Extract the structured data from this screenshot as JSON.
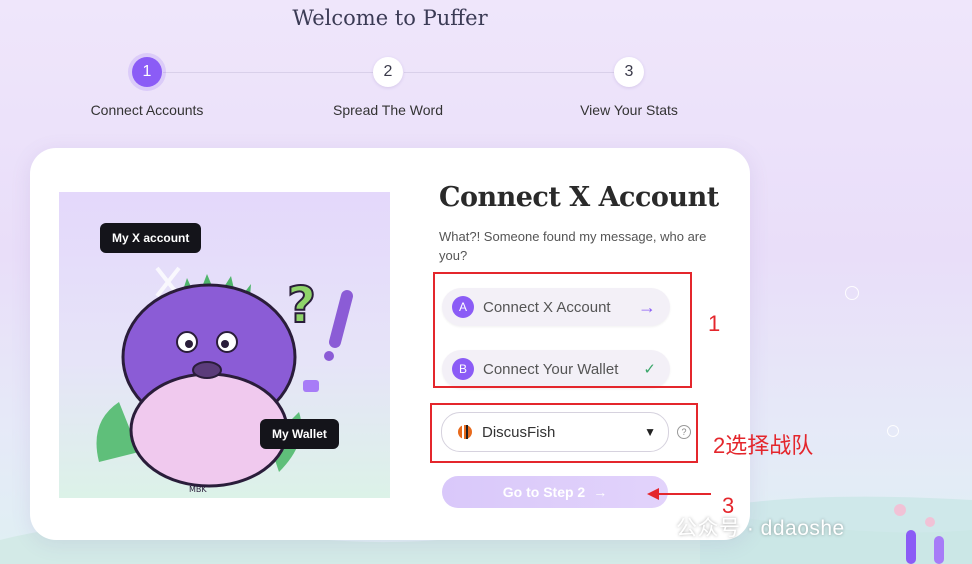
{
  "page": {
    "title": "Welcome to Puffer"
  },
  "steps": [
    {
      "number": "1",
      "label": "Connect Accounts",
      "active": true
    },
    {
      "number": "2",
      "label": "Spread The Word",
      "active": false
    },
    {
      "number": "3",
      "label": "View Your Stats",
      "active": false
    }
  ],
  "illustration": {
    "x_tooltip": "My X account",
    "wallet_tooltip": "My Wallet",
    "signature": "MBK"
  },
  "card": {
    "title": "Connect X Account",
    "subtitle": "What?! Someone found my message, who are you?",
    "option_a": {
      "badge": "A",
      "label": "Connect X Account",
      "icon": "arrow-right-icon"
    },
    "option_b": {
      "badge": "B",
      "label": "Connect Your Wallet",
      "icon": "check-icon"
    },
    "team_select": {
      "value": "DiscusFish",
      "help": "?"
    },
    "go_button": "Go to Step 2"
  },
  "annotations": {
    "label_1": "1",
    "label_2": "2选择战队",
    "label_3": "3"
  },
  "watermark": "公众号 · ddaoshe",
  "colors": {
    "accent": "#8b5cf6",
    "annotation_red": "#e4262c",
    "check_green": "#3aa66a"
  }
}
